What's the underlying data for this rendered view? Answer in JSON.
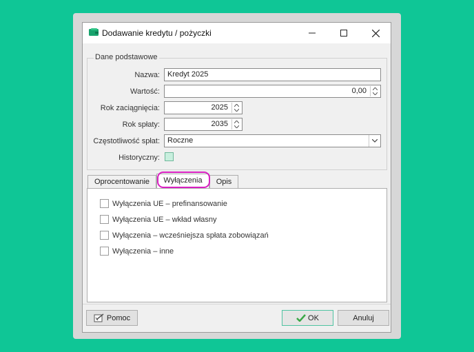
{
  "window": {
    "title": "Dodawanie kredytu / pożyczki"
  },
  "group": {
    "legend": "Dane podstawowe"
  },
  "fields": {
    "nazwa_label": "Nazwa:",
    "nazwa_value": "Kredyt 2025",
    "wartosc_label": "Wartość:",
    "wartosc_value": "0,00",
    "rok_zac_label": "Rok zaciągnięcia:",
    "rok_zac_value": "2025",
    "rok_spl_label": "Rok spłaty:",
    "rok_spl_value": "2035",
    "czest_label": "Częstotliwość spłat:",
    "czest_value": "Roczne",
    "hist_label": "Historyczny:"
  },
  "tabs": [
    {
      "label": "Oprocentowanie"
    },
    {
      "label": "Wyłączenia"
    },
    {
      "label": "Opis"
    }
  ],
  "exclusions": [
    {
      "label": "Wyłączenia UE – prefinansowanie"
    },
    {
      "label": "Wyłączenia UE – wkład własny"
    },
    {
      "label": "Wyłączenia – wcześniejsza spłata zobowiązań"
    },
    {
      "label": "Wyłączenia – inne"
    }
  ],
  "buttons": {
    "help": "Pomoc",
    "ok": "OK",
    "cancel": "Anuluj"
  },
  "colors": {
    "accent": "#d91fc2",
    "background": "#0fc696",
    "ok_check": "#3aa847"
  }
}
